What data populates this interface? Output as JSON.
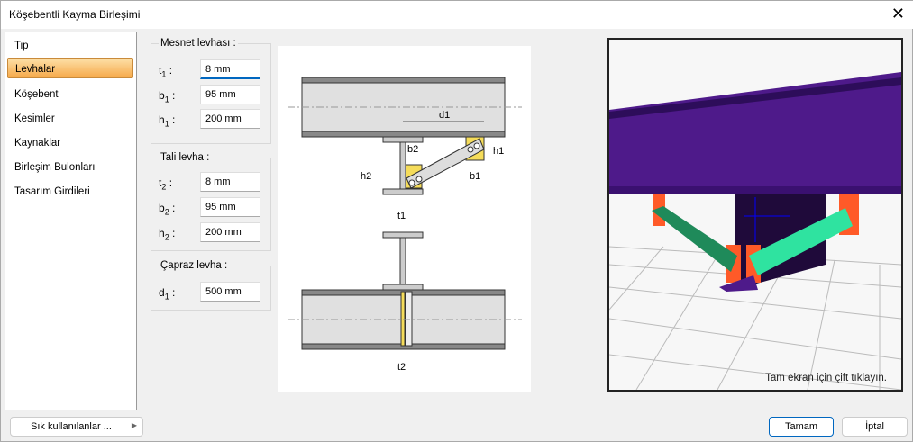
{
  "window": {
    "title": "Köşebentli Kayma Birleşimi",
    "close_icon": "close-icon"
  },
  "sidebar": {
    "items": [
      {
        "label": "Tip"
      },
      {
        "label": "Levhalar",
        "selected": true
      },
      {
        "label": "Köşebent"
      },
      {
        "label": "Kesimler"
      },
      {
        "label": "Kaynaklar"
      },
      {
        "label": "Birleşim Bulonları"
      },
      {
        "label": "Tasarım Girdileri"
      }
    ]
  },
  "mesnet": {
    "legend": "Mesnet levhası :",
    "t1": {
      "label": "t",
      "sub": "1",
      "value": "8 mm"
    },
    "b1": {
      "label": "b",
      "sub": "1",
      "value": "95 mm"
    },
    "h1": {
      "label": "h",
      "sub": "1",
      "value": "200 mm"
    }
  },
  "tali": {
    "legend": "Tali levha :",
    "t2": {
      "label": "t",
      "sub": "2",
      "value": "8 mm"
    },
    "b2": {
      "label": "b",
      "sub": "2",
      "value": "95 mm"
    },
    "h2": {
      "label": "h",
      "sub": "2",
      "value": "200 mm"
    }
  },
  "capraz": {
    "legend": "Çapraz levha :",
    "d1": {
      "label": "d",
      "sub": "1",
      "value": "500 mm"
    }
  },
  "diagram": {
    "d1": "d1",
    "b1": "b1",
    "b2": "b2",
    "h1": "h1",
    "h2": "h2",
    "t1": "t1",
    "t2": "t2"
  },
  "view3d": {
    "hint": "Tam ekran için çift tıklayın.",
    "colors": {
      "beam": "#4e1a8a",
      "angle": "#2fe3a0",
      "plate": "#ff5a28"
    }
  },
  "footer": {
    "favorites": "Sık kullanılanlar ...",
    "ok": "Tamam",
    "cancel": "İptal"
  }
}
